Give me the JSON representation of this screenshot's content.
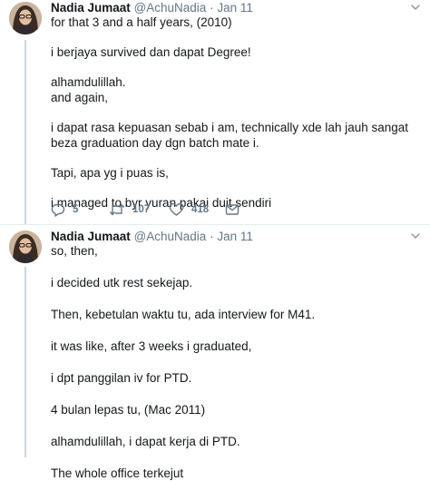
{
  "tweets": [
    {
      "author": {
        "name": "Nadia Jumaat",
        "handle": "@AchuNadia",
        "separator": "·",
        "time": "Jan 11"
      },
      "lines": [
        "for that 3 and a half years, (2010)",
        "i berjaya survived dan dapat Degree!",
        "alhamdulillah.",
        "and again,",
        "i dapat rasa kepuasan sebab i am, technically xde lah jauh sangat beza graduation day dgn batch mate i.",
        "Tapi, apa yg i puas is,",
        "i managed to byr yuran pakai duit sendiri"
      ],
      "stats": {
        "replies": "5",
        "retweets": "107",
        "likes": "418"
      }
    },
    {
      "author": {
        "name": "Nadia Jumaat",
        "handle": "@AchuNadia",
        "separator": "·",
        "time": "Jan 11"
      },
      "lines": [
        "so, then,",
        "i decided utk rest sekejap.",
        "Then, kebetulan waktu tu, ada interview for M41.",
        "it was like, after 3 weeks i graduated,",
        "i dpt panggilan iv for PTD.",
        "4 bulan lepas tu, (Mac 2011)",
        "alhamdulillah, i dapat kerja di PTD.",
        "The whole office terkejut"
      ]
    }
  ],
  "icons": {
    "reply": "reply-icon",
    "retweet": "retweet-icon",
    "like": "heart-icon",
    "dm": "envelope-icon",
    "more": "chevron-down-icon",
    "avatar": "avatar"
  },
  "colors": {
    "text": "#14171a",
    "muted": "#657786",
    "thread_line": "#ccd6dd",
    "divider": "#e6ecf0"
  }
}
